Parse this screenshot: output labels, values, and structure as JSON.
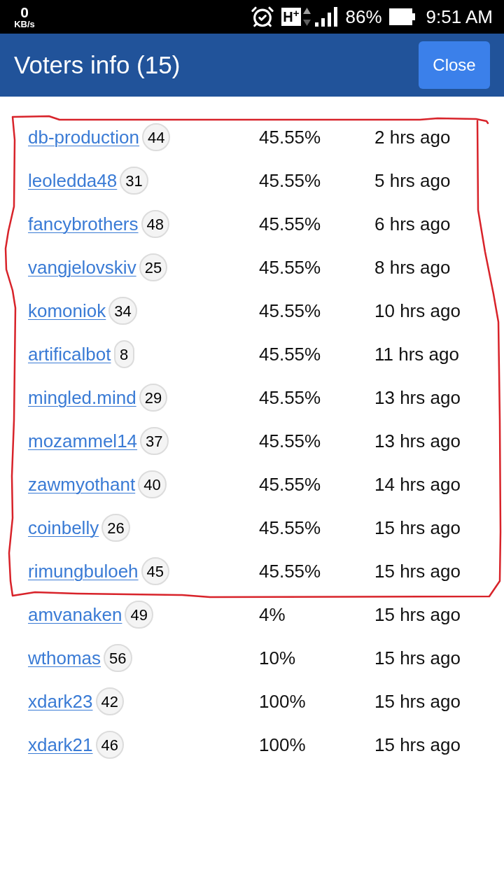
{
  "status_bar": {
    "speed_value": "0",
    "speed_unit": "KB/s",
    "network": "H$^{+}$",
    "battery": "86%",
    "time": "9:51 AM"
  },
  "header": {
    "title": "Voters info (15)",
    "close_button": "Close"
  },
  "voters": [
    {
      "name": "db-production",
      "reputation": "44",
      "percent": "45.55%",
      "time": "2 hrs ago"
    },
    {
      "name": "leoledda48",
      "reputation": "31",
      "percent": "45.55%",
      "time": "5 hrs ago"
    },
    {
      "name": "fancybrothers",
      "reputation": "48",
      "percent": "45.55%",
      "time": "6 hrs ago"
    },
    {
      "name": "vangjelovskiv",
      "reputation": "25",
      "percent": "45.55%",
      "time": "8 hrs ago"
    },
    {
      "name": "komoniok",
      "reputation": "34",
      "percent": "45.55%",
      "time": "10 hrs ago"
    },
    {
      "name": "artificalbot",
      "reputation": "8",
      "percent": "45.55%",
      "time": "11 hrs ago"
    },
    {
      "name": "mingled.mind",
      "reputation": "29",
      "percent": "45.55%",
      "time": "13 hrs ago"
    },
    {
      "name": "mozammel14",
      "reputation": "37",
      "percent": "45.55%",
      "time": "13 hrs ago"
    },
    {
      "name": "zawmyothant",
      "reputation": "40",
      "percent": "45.55%",
      "time": "14 hrs ago"
    },
    {
      "name": "coinbelly",
      "reputation": "26",
      "percent": "45.55%",
      "time": "15 hrs ago"
    },
    {
      "name": "rimungbuloeh",
      "reputation": "45",
      "percent": "45.55%",
      "time": "15 hrs ago"
    },
    {
      "name": "amvanaken",
      "reputation": "49",
      "percent": "4%",
      "time": "15 hrs ago"
    },
    {
      "name": "wthomas",
      "reputation": "56",
      "percent": "10%",
      "time": "15 hrs ago"
    },
    {
      "name": "xdark23",
      "reputation": "42",
      "percent": "100%",
      "time": "15 hrs ago"
    },
    {
      "name": "xdark21",
      "reputation": "46",
      "percent": "100%",
      "time": "15 hrs ago"
    }
  ]
}
